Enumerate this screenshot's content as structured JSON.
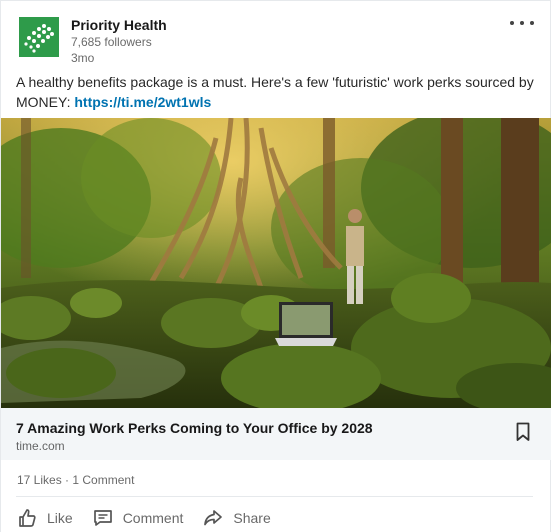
{
  "company": {
    "name": "Priority Health",
    "followers": "7,685 followers",
    "time": "3mo"
  },
  "post": {
    "text": "A healthy benefits package is a must. Here's a few 'futuristic' work perks sourced by MONEY: ",
    "link": "https://ti.me/2wt1wls"
  },
  "article": {
    "title": "7 Amazing Work Perks Coming to Your Office by 2028",
    "source": "time.com"
  },
  "social": {
    "likes": "17 Likes",
    "separator": " · ",
    "comments": "1 Comment"
  },
  "actions": {
    "like": "Like",
    "comment": "Comment",
    "share": "Share"
  },
  "colors": {
    "link": "#0073b1",
    "logo": "#2e9b4a"
  }
}
